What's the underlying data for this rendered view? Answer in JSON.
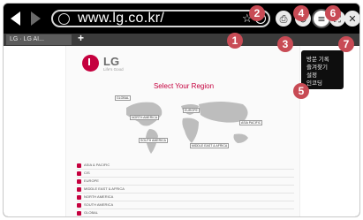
{
  "toolbar": {
    "url": "www.lg.co.kr/",
    "back_icon": "back-arrow-icon",
    "forward_icon": "forward-arrow-icon",
    "buttons": [
      {
        "name": "print-icon",
        "glyph": "⎙"
      },
      {
        "name": "zoom-icon",
        "glyph": "⊕"
      },
      {
        "name": "menu-icon",
        "glyph": "≡"
      },
      {
        "name": "fullscreen-icon",
        "glyph": "⛶"
      },
      {
        "name": "close-icon",
        "glyph": "✕"
      }
    ]
  },
  "tabs": [
    {
      "label": "LG · LG AI..."
    }
  ],
  "new_tab_label": "+",
  "page": {
    "logo_text": "LG",
    "logo_tagline": "Life's Good",
    "region_title": "Select Your Region",
    "map_labels": [
      "GLOBAL",
      "NORTH AMERICA",
      "EUROPE",
      "SOUTH AMERICA",
      "MIDDLE EAST & AFRICA",
      "ASIA PACIFIC"
    ],
    "regions": [
      "ASIA & PACIFIC",
      "CIS",
      "EUROPE",
      "MIDDLE EAST & AFRICA",
      "NORTH AMERICA",
      "SOUTH AMERICA",
      "GLOBAL"
    ]
  },
  "menu": {
    "items": [
      "방문 기록",
      "즐겨찾기",
      "설정",
      "인코딩"
    ]
  },
  "callouts": [
    "1",
    "2",
    "3",
    "4",
    "5",
    "6",
    "7"
  ],
  "colors": {
    "accent": "#c5003e",
    "callout": "#c84b55",
    "toolbar_bg": "#000000"
  }
}
